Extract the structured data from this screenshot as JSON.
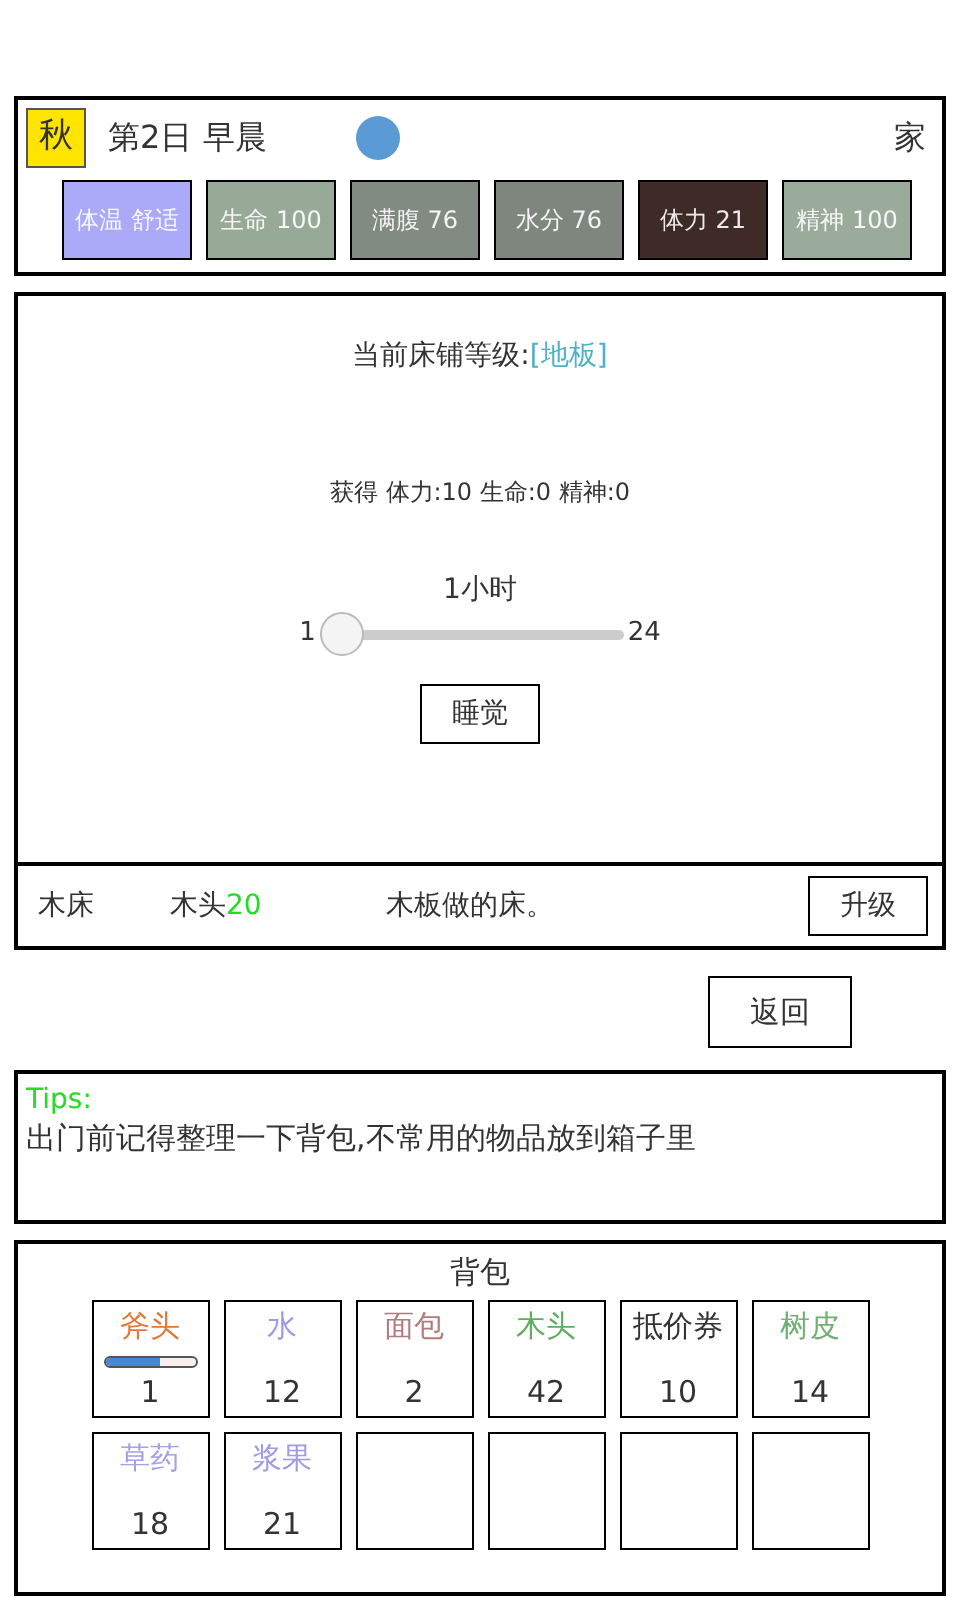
{
  "header": {
    "season": "秋",
    "day_time": "第2日 早晨",
    "location": "家",
    "stats": [
      {
        "label": "体温 舒适",
        "color": "#aaaaf8"
      },
      {
        "label": "生命 100",
        "color": "#97a997"
      },
      {
        "label": "满腹 76",
        "color": "#818b81"
      },
      {
        "label": "水分 76",
        "color": "#7e867e"
      },
      {
        "label": "体力 21",
        "color": "#3e2b27"
      },
      {
        "label": "精神 100",
        "color": "#9bab9b"
      }
    ]
  },
  "bed": {
    "level_label": "当前床铺等级:",
    "level_value": "[地板]",
    "gain": "获得 体力:10  生命:0  精神:0",
    "slider": {
      "reading": "1小时",
      "min": "1",
      "max": "24",
      "level": 0
    },
    "sleep_button": "睡觉"
  },
  "upgrade_row": {
    "name": "木床",
    "cost_item": "木头",
    "cost_amount": "20",
    "description": "木板做的床。",
    "button": "升级"
  },
  "back_button": "返回",
  "tips": {
    "title": "Tips:",
    "text": "出门前记得整理一下背包,不常用的物品放到箱子里"
  },
  "backpack": {
    "title": "背包",
    "slots": [
      {
        "kind": "item",
        "name": "斧头",
        "count": "1",
        "color": "#e07838",
        "level": 0.6
      },
      {
        "kind": "item",
        "name": "水",
        "count": "12",
        "color": "#9c9ce0"
      },
      {
        "kind": "item",
        "name": "面包",
        "count": "2",
        "color": "#b07c7c"
      },
      {
        "kind": "item",
        "name": "木头",
        "count": "42",
        "color": "#5fae5f"
      },
      {
        "kind": "item",
        "name": "抵价券",
        "count": "10",
        "color": "#333333"
      },
      {
        "kind": "item",
        "name": "树皮",
        "count": "14",
        "color": "#70b070"
      },
      {
        "kind": "item",
        "name": "草药",
        "count": "18",
        "color": "#a2a2e2"
      },
      {
        "kind": "item",
        "name": "浆果",
        "count": "21",
        "color": "#9c9ce0"
      },
      {
        "kind": "empty"
      },
      {
        "kind": "empty"
      },
      {
        "kind": "empty"
      },
      {
        "kind": "empty"
      }
    ]
  }
}
